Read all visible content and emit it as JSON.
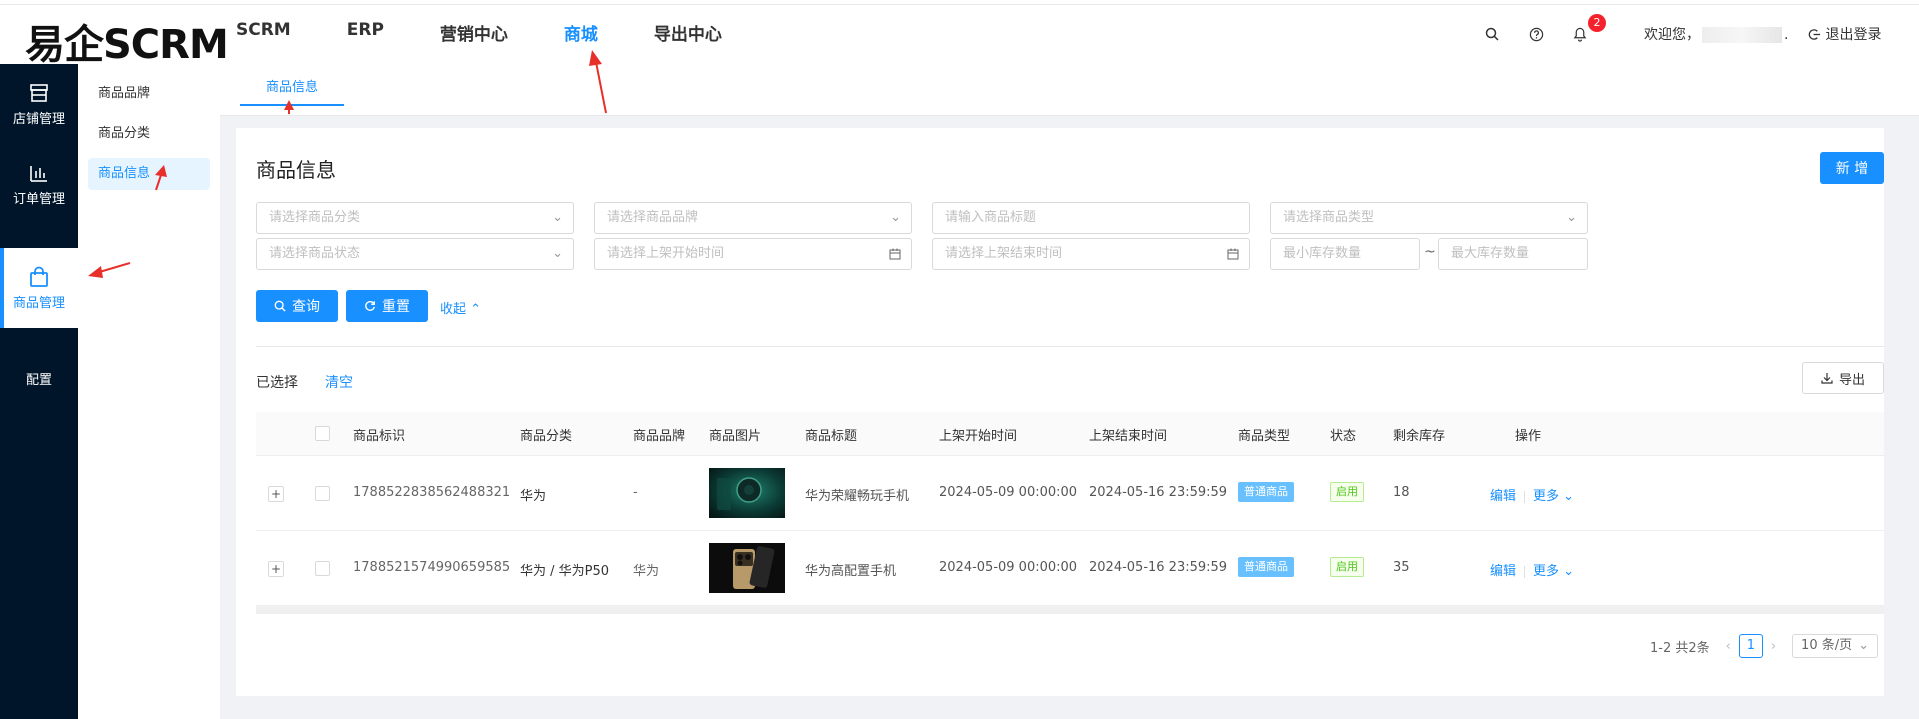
{
  "app": {
    "logo": "易企SCRM"
  },
  "topnav": [
    {
      "label": "SCRM",
      "active": false
    },
    {
      "label": "ERP",
      "active": false
    },
    {
      "label": "营销中心",
      "active": false
    },
    {
      "label": "商城",
      "active": true
    },
    {
      "label": "导出中心",
      "active": false
    }
  ],
  "header": {
    "notification_count": "2",
    "welcome": "欢迎您，",
    "welcome_suffix": ".",
    "logout": "退出登录"
  },
  "rail": [
    {
      "label": "店铺管理",
      "icon": "store-icon"
    },
    {
      "label": "订单管理",
      "icon": "bar-chart-icon"
    },
    {
      "label": "商品管理",
      "icon": "shopping-bag-icon",
      "active": true
    },
    {
      "label": "配置",
      "icon": ""
    }
  ],
  "submenu": [
    {
      "label": "商品品牌"
    },
    {
      "label": "商品分类"
    },
    {
      "label": "商品信息",
      "active": true
    }
  ],
  "tabs": [
    {
      "label": "商品信息"
    }
  ],
  "page": {
    "title": "商品信息",
    "new_button": "新 增"
  },
  "filters": {
    "category": "请选择商品分类",
    "brand": "请选择商品品牌",
    "title": "请输入商品标题",
    "type": "请选择商品类型",
    "status": "请选择商品状态",
    "start_time": "请选择上架开始时间",
    "end_time": "请选择上架结束时间",
    "min_stock": "最小库存数量",
    "max_stock": "最大库存数量",
    "range_sep": "~"
  },
  "actions": {
    "query": "查询",
    "reset": "重置",
    "collapse": "收起"
  },
  "selection": {
    "label": "已选择",
    "clear": "清空",
    "export": "导出"
  },
  "table": {
    "columns": [
      "商品标识",
      "商品分类",
      "商品品牌",
      "商品图片",
      "商品标题",
      "上架开始时间",
      "上架结束时间",
      "商品类型",
      "状态",
      "剩余库存",
      "操作"
    ],
    "rows": [
      {
        "id": "1788522838562488321",
        "category": "华为",
        "brand": "-",
        "title": "华为荣耀畅玩手机",
        "start": "2024-05-09 00:00:00",
        "end": "2024-05-16 23:59:59",
        "type": "普通商品",
        "status": "启用",
        "stock": "18",
        "edit": "编辑",
        "more": "更多"
      },
      {
        "id": "1788521574990659585",
        "category": "华为 / 华为P50",
        "brand": "华为",
        "title": "华为高配置手机",
        "start": "2024-05-09 00:00:00",
        "end": "2024-05-16 23:59:59",
        "type": "普通商品",
        "status": "启用",
        "stock": "35",
        "edit": "编辑",
        "more": "更多"
      }
    ]
  },
  "pagination": {
    "total": "1-2 共2条",
    "current": "1",
    "page_size": "10 条/页"
  },
  "colors": {
    "primary": "#1890ff",
    "rail": "#001529",
    "annotation_arrow": "#e8302a"
  }
}
